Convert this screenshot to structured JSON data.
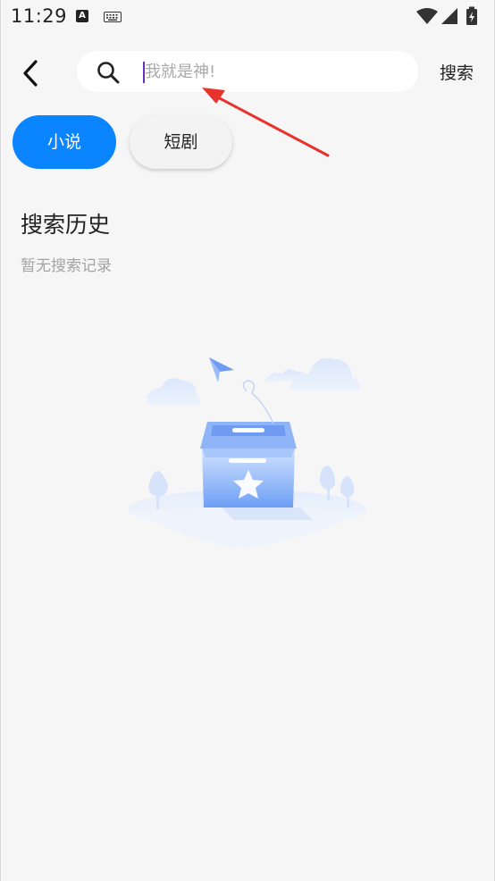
{
  "status_bar": {
    "time": "11:29",
    "notification_a": "A"
  },
  "search": {
    "placeholder": "我就是神!",
    "submit_label": "搜索"
  },
  "tabs": [
    {
      "label": "小说",
      "active": true
    },
    {
      "label": "短剧",
      "active": false
    }
  ],
  "history": {
    "title": "搜索历史",
    "empty_text": "暂无搜索记录"
  },
  "colors": {
    "accent": "#0a84ff",
    "background": "#f6f6f6",
    "annotation_arrow": "#e8332c"
  },
  "icons": [
    "back-arrow-icon",
    "search-icon",
    "wifi-icon",
    "signal-icon",
    "battery-icon",
    "keyboard-icon",
    "empty-box-illustration"
  ]
}
